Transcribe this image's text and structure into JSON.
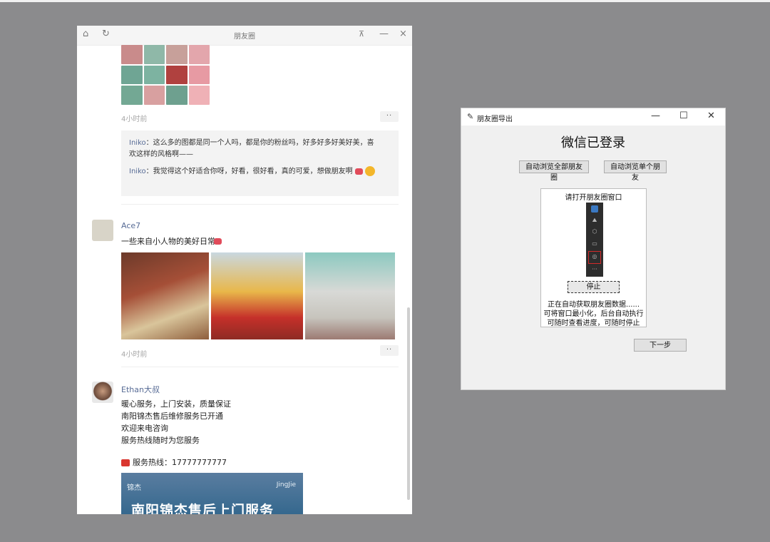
{
  "moments_window": {
    "title": "朋友圈",
    "titlebar_icons": [
      "home-icon",
      "refresh-icon",
      "pin-icon",
      "minimize-icon",
      "close-icon"
    ],
    "post1": {
      "time": "4小时前",
      "more": "··",
      "comments": [
        {
          "name": "Iniko",
          "text": "：这么多的图都是同一个人吗，都是你的粉丝吗，好多好多好美好美，喜欢这样的风格啊——"
        },
        {
          "name": "Iniko",
          "text": "：我觉得这个好适合你呀，好看，很好看，真的可爱，想做朋友啊"
        }
      ]
    },
    "post2": {
      "name": "Ace7",
      "text": "一些来自小人物的美好日常",
      "time": "4小时前",
      "more": "··"
    },
    "post3": {
      "name": "Ethan大叔",
      "lines": [
        "暖心服务，上门安装，质量保证",
        "南阳锦杰售后维修服务已开通",
        "欢迎来电咨询",
        "服务热线随时为您服务"
      ],
      "phone_line": "服务热线：17777777777",
      "card_small": "锦杰",
      "card_brand": "JingJie",
      "card_title": "南阳锦杰售后上门服务"
    }
  },
  "export_dialog": {
    "title": "朋友圈导出",
    "heading": "微信已登录",
    "btn_all": "自动浏览全部朋友圈",
    "btn_single": "自动浏览单个朋友",
    "guide_title": "请打开朋友圈窗口",
    "stop_button": "停止",
    "status_lines": [
      "正在自动获取朋友圈数据......",
      "可将窗口最小化，后台自动执行",
      "可随时查看进度，可随时停止"
    ],
    "next_button": "下一步",
    "controls": [
      "minimize-icon",
      "maximize-icon",
      "close-icon"
    ]
  },
  "colors": {
    "desktop": "#8b8b8d",
    "link_blue": "#576b95",
    "heart": "#e14b5a",
    "highlight_red": "#d32a2a"
  }
}
